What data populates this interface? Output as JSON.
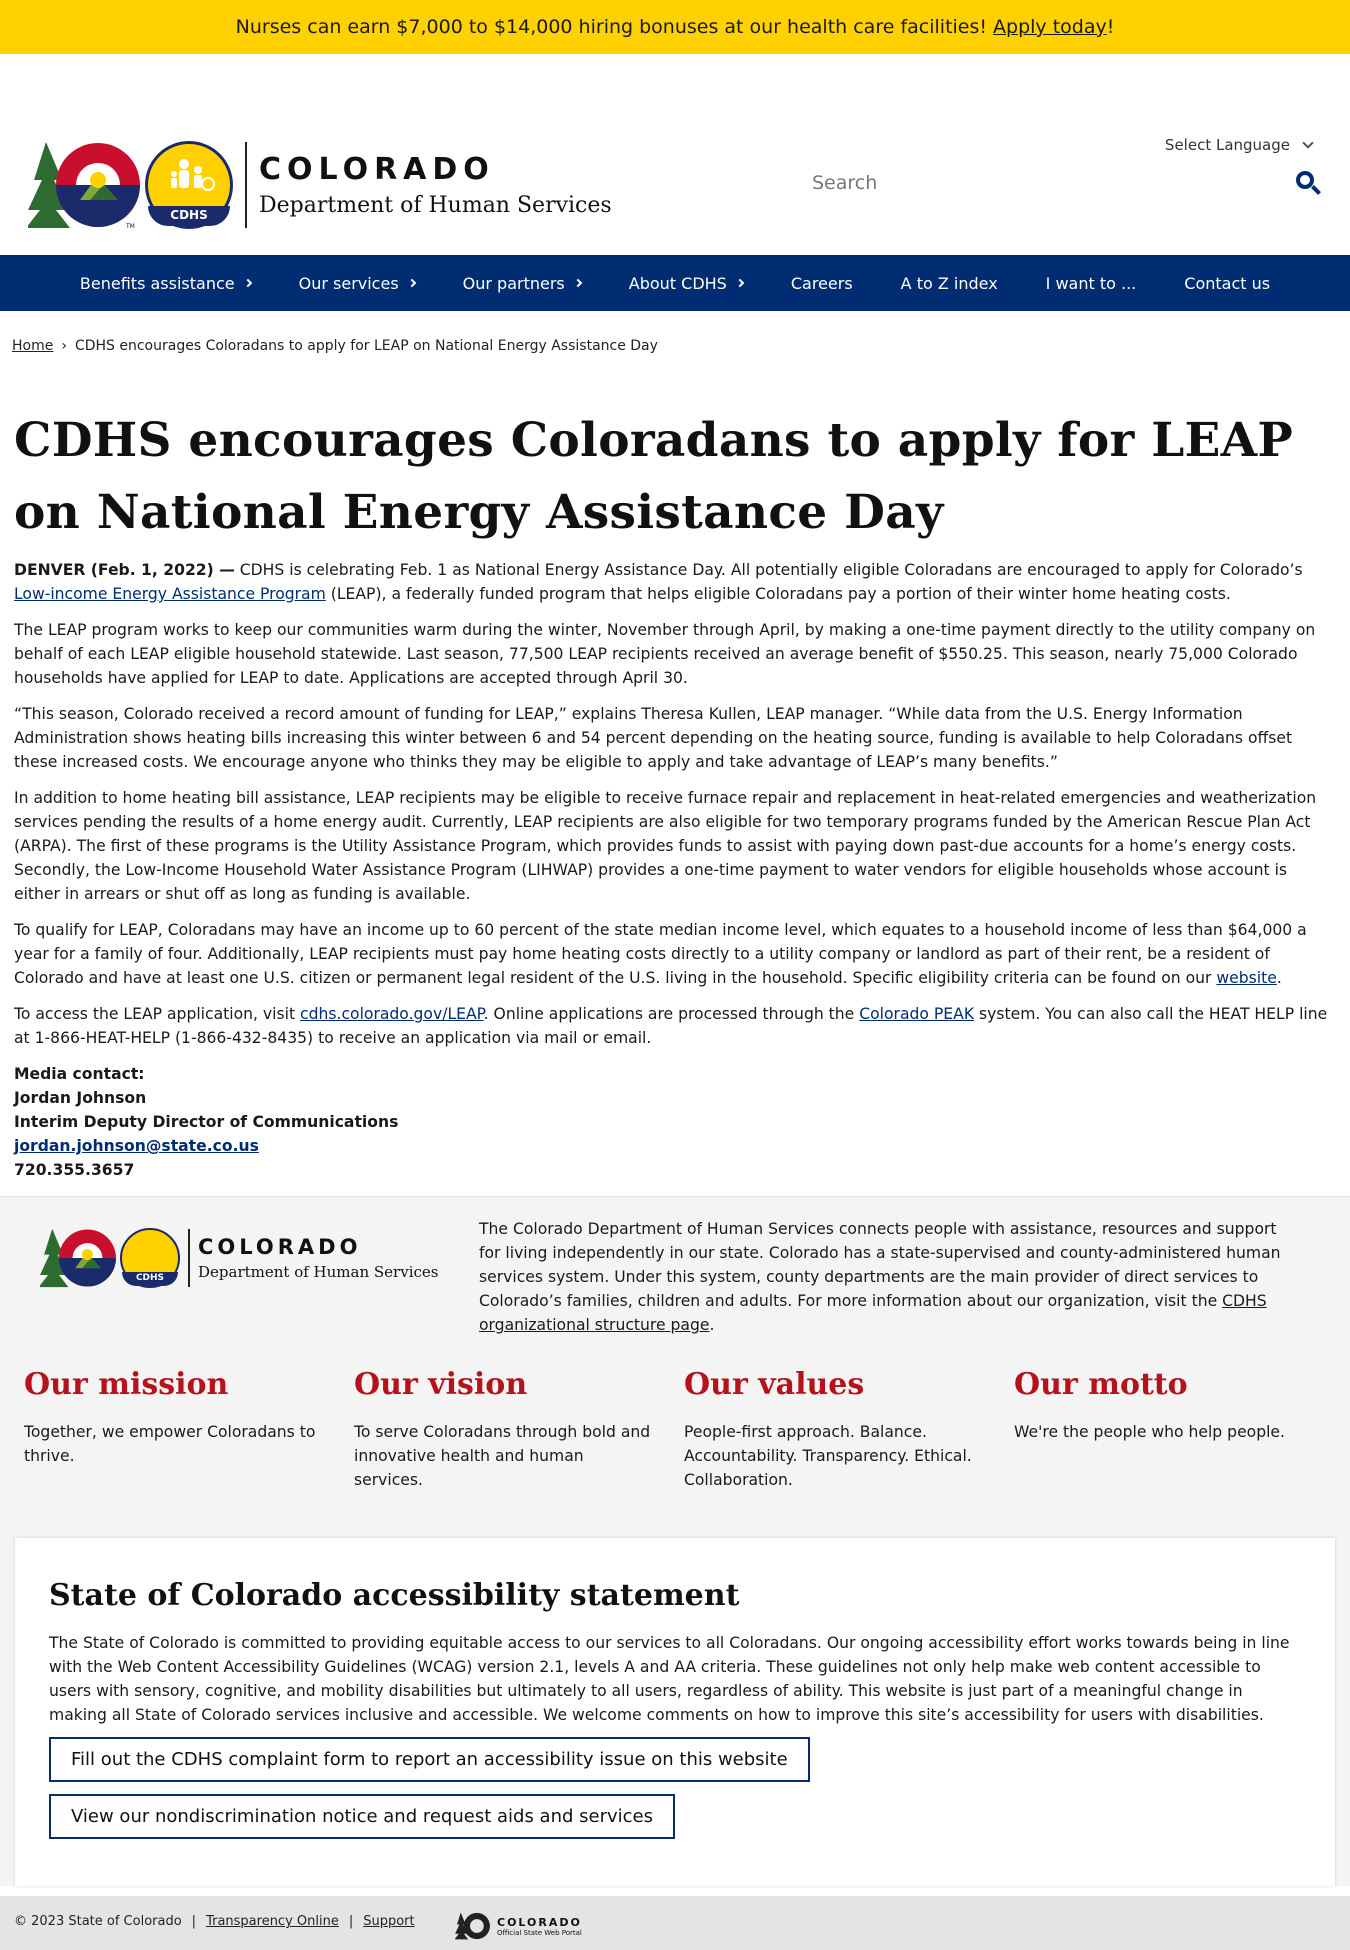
{
  "banner": {
    "text": "Nurses can earn $7,000 to $14,000 hiring bonuses at our health care facilities!",
    "link": "Apply today",
    "suffix": "!"
  },
  "header": {
    "language": "Select Language",
    "logo_state": "COLORADO",
    "logo_dept": "Department of Human Services",
    "logo_badge": "CDHS",
    "search_placeholder": "Search"
  },
  "nav": {
    "items": [
      {
        "label": "Benefits assistance",
        "arrow": true
      },
      {
        "label": "Our services",
        "arrow": true
      },
      {
        "label": "Our partners",
        "arrow": true
      },
      {
        "label": "About CDHS",
        "arrow": true
      },
      {
        "label": "Careers",
        "arrow": false
      },
      {
        "label": "A to Z index",
        "arrow": false
      },
      {
        "label": "I want to ...",
        "arrow": false
      },
      {
        "label": "Contact us",
        "arrow": false
      }
    ]
  },
  "breadcrumb": {
    "home": "Home",
    "sep": "›",
    "current": "CDHS encourages Coloradans to apply for LEAP on National Energy Assistance Day"
  },
  "article": {
    "title": "CDHS encourages Coloradans to apply for LEAP on National Energy Assistance Day",
    "p1_dateline": "DENVER (Feb. 1, 2022) —",
    "p1_a": " CDHS is celebrating Feb. 1 as National Energy Assistance Day. All potentially eligible Coloradans are encouraged to apply for Colorado’s ",
    "p1_link": "Low-income Energy Assistance Program",
    "p1_b": " (LEAP), a federally funded program that helps eligible Coloradans pay a portion of their winter home heating costs.",
    "p2": "The LEAP program works to keep our communities warm during the winter, November through April, by making a one-time payment directly to the utility company on behalf of each LEAP eligible household statewide. Last season, 77,500 LEAP recipients received an average benefit of $550.25. This season, nearly 75,000 Colorado households have applied for LEAP to date. Applications are accepted through April 30.",
    "p3": "“This season, Colorado received a record amount of funding for LEAP,” explains Theresa Kullen, LEAP manager. “While data from the U.S. Energy Information Administration shows heating bills increasing this winter between 6 and 54 percent depending on the heating source, funding is available to help Coloradans offset these increased costs. We encourage anyone who thinks they may be eligible to apply and take advantage of LEAP’s many benefits.”",
    "p4": "In addition to home heating bill assistance, LEAP recipients may be eligible to receive furnace repair and replacement in heat-related emergencies and weatherization services pending the results of a home energy audit. Currently, LEAP recipients are also eligible for two temporary programs funded by  the American Rescue Plan Act (ARPA). The first of these programs is the Utility Assistance Program, which provides funds to assist with paying down past-due accounts for a home’s energy costs. Secondly, the Low-Income Household Water Assistance Program (LIHWAP) provides a one-time payment to water vendors for eligible households whose account is either in arrears or shut off as long as funding is available.",
    "p5_a": "To qualify for LEAP, Coloradans may have an income up to 60 percent of the state median income level, which equates to a household income of less than $64,000 a year for a family of four. Additionally, LEAP recipients must pay home heating costs directly to a utility company or landlord as part of their rent, be a resident of Colorado and have at least one U.S. citizen or permanent legal resident of the U.S. living in the household. Specific eligibility criteria can be found on our ",
    "p5_link": "website",
    "p5_b": ".",
    "p6_a": "To access the LEAP application, visit ",
    "p6_link1": "cdhs.colorado.gov/LEAP",
    "p6_b": ". Online applications are processed through the ",
    "p6_link2": "Colorado PEAK",
    "p6_c": " system. You can also call the HEAT HELP line at 1-866-HEAT-HELP (1-866-432-8435) to receive an application via mail or email.",
    "contact_label": "Media contact:",
    "contact_name": "Jordan Johnson",
    "contact_title": "Interim Deputy Director of Communications",
    "contact_email": "jordan.johnson@state.co.us",
    "contact_phone": "720.355.3657"
  },
  "footer": {
    "about_a": "The Colorado Department of Human Services connects people with assistance, resources and support for living independently in our state. Colorado has a state-supervised and county-administered human services system. Under this system, county departments are the main provider of direct services to Colorado’s families, children and adults. For more information about our organization, visit the ",
    "about_link": "CDHS organizational structure page",
    "about_b": ".",
    "pillars": [
      {
        "title": "Our mission",
        "text": "Together, we empower Coloradans to thrive."
      },
      {
        "title": "Our vision",
        "text": "To serve Coloradans through bold and innovative health and human services."
      },
      {
        "title": "Our values",
        "text": "People-first approach. Balance. Accountability. Transparency. Ethical. Collaboration."
      },
      {
        "title": "Our motto",
        "text": "We're the people who help people."
      }
    ],
    "a11y_title": "State of Colorado accessibility statement",
    "a11y_text": "The State of Colorado is committed to providing equitable access to our services to all Coloradans. Our ongoing accessibility effort works towards being in line with the Web Content Accessibility Guidelines (WCAG) version 2.1, levels A and AA criteria. These guidelines not only help make web content accessible to users with sensory, cognitive, and mobility disabilities but ultimately to all users, regardless of ability. This website is just part of a meaningful change in making all State of Colorado services inclusive and accessible. We welcome comments on how to improve this site’s accessibility for users with disabilities.",
    "a11y_btn1": "Fill out the CDHS complaint form to report an accessibility issue on this website",
    "a11y_btn2": "View our nondiscrimination notice and request aids and services",
    "copyright": "© 2023 State of Colorado",
    "sep": "|",
    "link_transparency": "Transparency Online",
    "link_support": "Support",
    "portal_state": "COLORADO",
    "portal_sub": "Official State Web Portal"
  },
  "colors": {
    "banner": "#ffd100",
    "nav": "#002d72",
    "accent_red": "#b5121b",
    "footer_bg": "#f4f4f4"
  }
}
